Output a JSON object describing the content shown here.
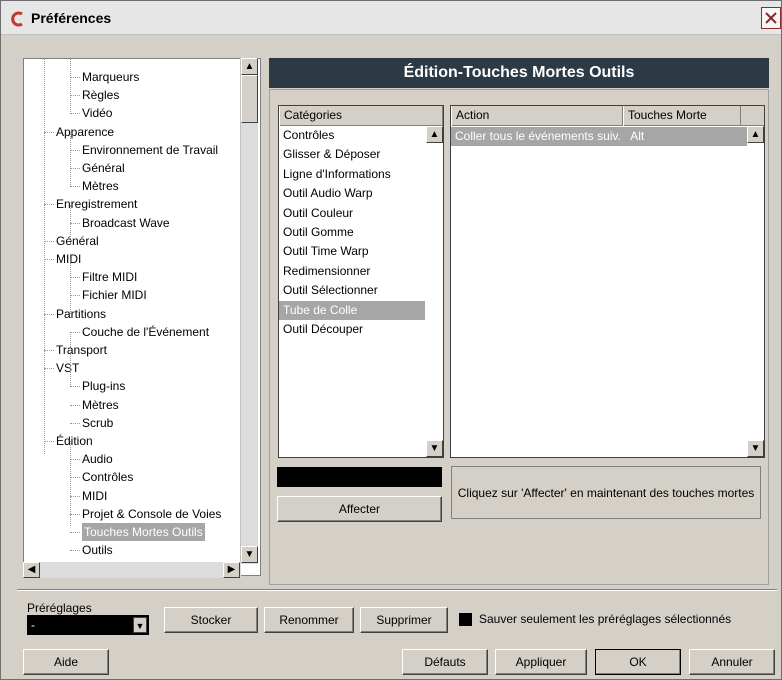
{
  "window": {
    "title": "Préférences",
    "close_icon": "close-icon"
  },
  "tree": {
    "items": [
      {
        "label": "Marqueurs",
        "level": 2
      },
      {
        "label": "Règles",
        "level": 2
      },
      {
        "label": "Vidéo",
        "level": 2
      },
      {
        "label": "Apparence",
        "level": 1
      },
      {
        "label": "Environnement de Travail",
        "level": 2
      },
      {
        "label": "Général",
        "level": 2
      },
      {
        "label": "Mètres",
        "level": 2
      },
      {
        "label": "Enregistrement",
        "level": 1
      },
      {
        "label": "Broadcast Wave",
        "level": 2
      },
      {
        "label": "Général",
        "level": 1
      },
      {
        "label": "MIDI",
        "level": 1
      },
      {
        "label": "Filtre MIDI",
        "level": 2
      },
      {
        "label": "Fichier MIDI",
        "level": 2
      },
      {
        "label": "Partitions",
        "level": 1
      },
      {
        "label": "Couche de l'Événement",
        "level": 2
      },
      {
        "label": "Transport",
        "level": 1
      },
      {
        "label": "VST",
        "level": 1
      },
      {
        "label": "Plug-ins",
        "level": 2
      },
      {
        "label": "Mètres",
        "level": 2
      },
      {
        "label": "Scrub",
        "level": 2
      },
      {
        "label": "Édition",
        "level": 1
      },
      {
        "label": "Audio",
        "level": 2
      },
      {
        "label": "Contrôles",
        "level": 2
      },
      {
        "label": "MIDI",
        "level": 2
      },
      {
        "label": "Projet & Console de Voies",
        "level": 2
      },
      {
        "label": "Touches Mortes Outils",
        "level": 2,
        "selected": true
      },
      {
        "label": "Outils",
        "level": 2
      }
    ]
  },
  "panel": {
    "title": "Édition-Touches Mortes Outils"
  },
  "categories": {
    "header": "Catégories",
    "items": [
      "Contrôles",
      "Glisser & Déposer",
      "Ligne d'Informations",
      "Outil Audio Warp",
      "Outil Couleur",
      "Outil Gomme",
      "Outil Time Warp",
      "Redimensionner",
      "Outil Sélectionner",
      "Tube de Colle",
      "Outil Découper"
    ],
    "selected": "Tube de Colle"
  },
  "actions": {
    "header_action": "Action",
    "header_keys": "Touches Morte",
    "rows": [
      {
        "action": "Coller tous le événements suiv.",
        "keys": "Alt"
      }
    ]
  },
  "assign": {
    "button_label": "Affecter",
    "hint": "Cliquez sur 'Affecter' en maintenant des touches mortes"
  },
  "presets": {
    "label": "Préréglages",
    "value": "-",
    "store_label": "Stocker",
    "rename_label": "Renommer",
    "delete_label": "Supprimer",
    "save_selected_label": "Sauver seulement les préréglages sélectionnés"
  },
  "footer": {
    "help_label": "Aide",
    "defaults_label": "Défauts",
    "apply_label": "Appliquer",
    "ok_label": "OK",
    "cancel_label": "Annuler"
  }
}
